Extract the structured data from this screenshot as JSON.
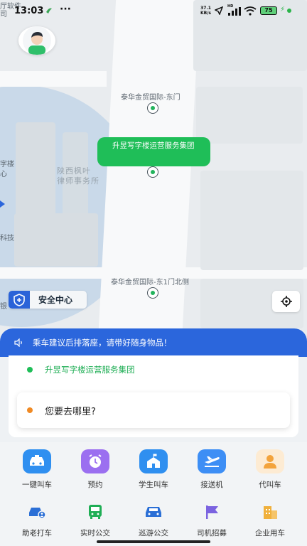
{
  "statusbar": {
    "time": "13:03",
    "net_speed_top": "37.1",
    "net_speed_unit": "KB/s",
    "hd_badge": "HD",
    "battery": "75",
    "edge_text": "厅软件"
  },
  "map": {
    "poi_top": "泰华金贸国际-东门",
    "poi_bottom": "泰华金贸国际-东1门北侧",
    "bubble_text": "升昱写字楼运营服务集团",
    "label_lawfirm_1": "陕西枫叶",
    "label_lawfirm_2": "律师事务所",
    "label_left_1": "字楼",
    "label_left_2": "心",
    "label_left_3": "科技",
    "label_left_4": "银",
    "label_top_left": "司"
  },
  "safety": {
    "label": "安全中心"
  },
  "notice": {
    "text": "乘车建议后排落座，请带好随身物品！"
  },
  "trip": {
    "origin": "升昱写字楼运营服务集团",
    "destination_placeholder": "您要去哪里?"
  },
  "services_row1": [
    {
      "label": "一键叫车",
      "icon": "taxi-icon",
      "color": "#2f8ff0"
    },
    {
      "label": "预约",
      "icon": "alarm-clock-icon",
      "color": "#9b6ff0"
    },
    {
      "label": "学生叫车",
      "icon": "school-icon",
      "color": "#2f8ff0"
    },
    {
      "label": "接送机",
      "icon": "airplane-icon",
      "color": "#3d8ef5"
    },
    {
      "label": "代叫车",
      "icon": "person-icon",
      "color": "#f3a33c"
    }
  ],
  "services_row2": [
    {
      "label": "助老打车",
      "icon": "elder-car-icon",
      "color": "#2b6fd6"
    },
    {
      "label": "实时公交",
      "icon": "bus-icon",
      "color": "#1fae55"
    },
    {
      "label": "巡游公交",
      "icon": "cruise-car-icon",
      "color": "#2b6fd6"
    },
    {
      "label": "司机招募",
      "icon": "flag-icon",
      "color": "#7b63e0"
    },
    {
      "label": "企业用车",
      "icon": "building-icon",
      "color": "#f0b03c"
    }
  ],
  "colors": {
    "primary_blue": "#2b66dc",
    "green": "#1fbe58",
    "orange_dot": "#f08a24"
  }
}
